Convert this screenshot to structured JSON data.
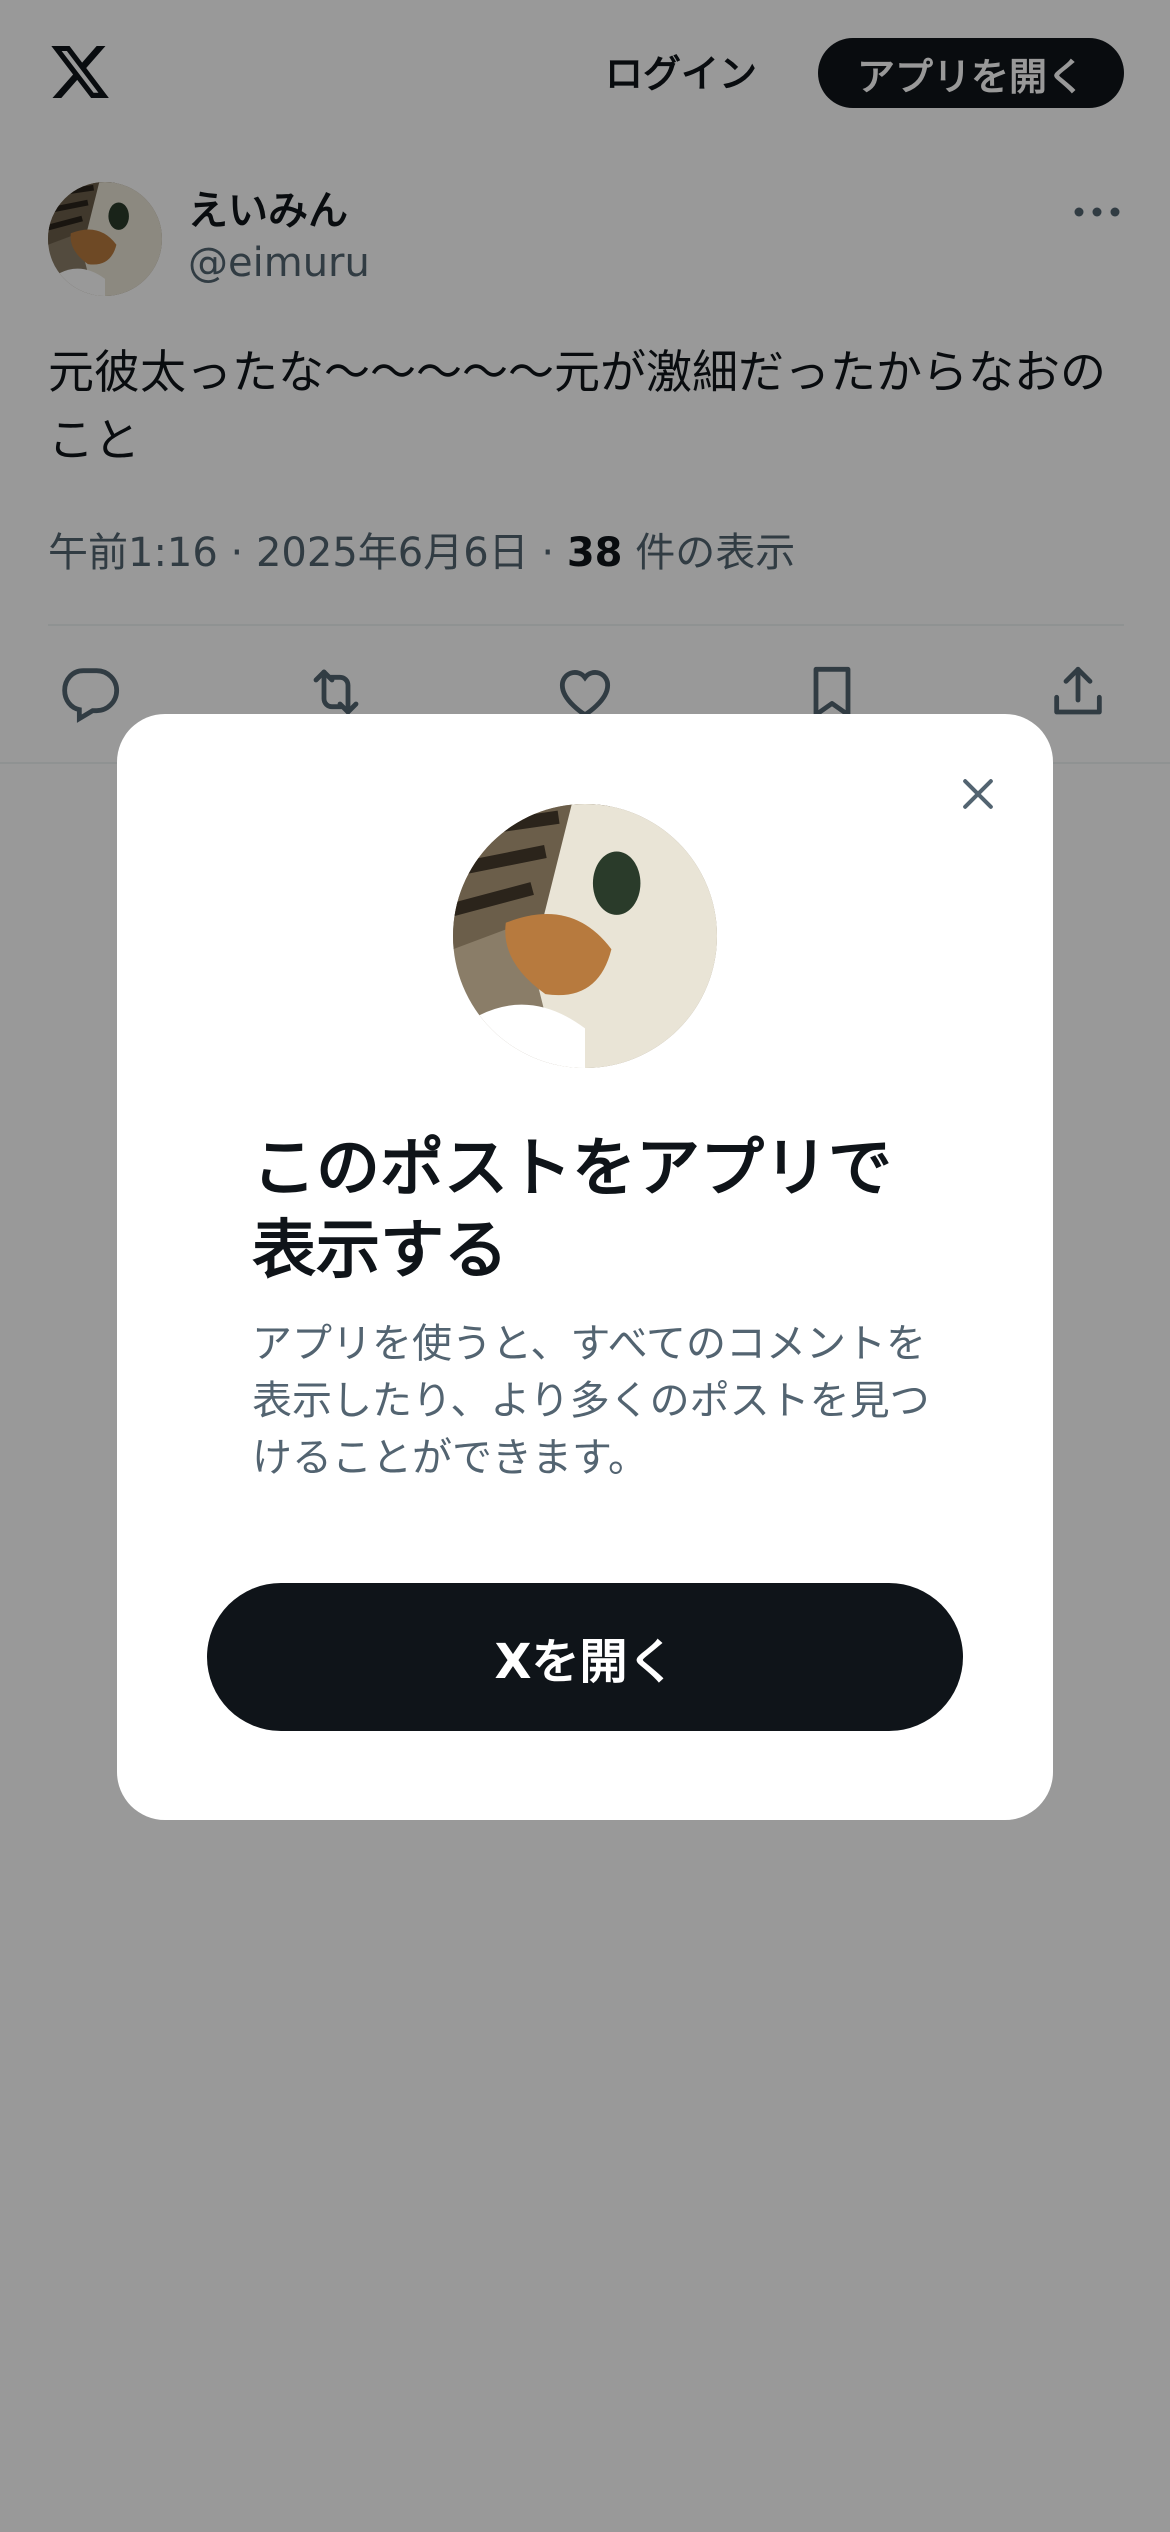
{
  "header": {
    "logo_icon": "x-logo-icon",
    "login_label": "ログイン",
    "open_app_label": "アプリを開く"
  },
  "post": {
    "display_name": "えいみん",
    "handle": "@eimuru",
    "text": "元彼太ったな〜〜〜〜〜元が激細だったからなおのこと",
    "time": "午前1:16",
    "separator": "·",
    "date": "2025年6月6日",
    "views_count": "38",
    "views_label": "件の表示",
    "more_icon": "more-icon",
    "actions": [
      "reply-icon",
      "repost-icon",
      "like-icon",
      "bookmark-icon",
      "share-icon"
    ]
  },
  "modal": {
    "close_icon": "close-icon",
    "title": "このポストをアプリで表示する",
    "description": "アプリを使うと、すべてのコメントを表示したり、より多くのポストを見つけることができます。",
    "button_label": "Xを開く"
  },
  "colors": {
    "text_primary": "#0f1419",
    "text_secondary": "#536471",
    "button_bg": "#0f1419",
    "overlay": "rgba(0,0,0,0.4)",
    "divider": "#eff3f4"
  }
}
